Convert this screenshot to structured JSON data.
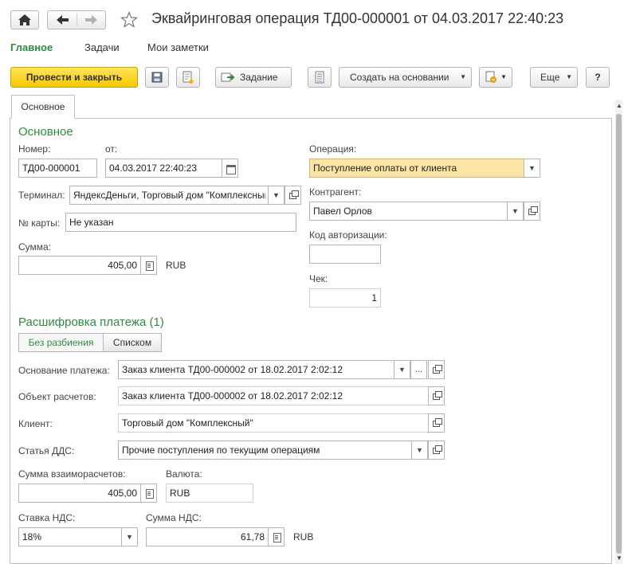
{
  "window": {
    "title": "Эквайринговая операция ТД00-000001 от 04.03.2017 22:40:23",
    "nav": [
      "Главное",
      "Задачи",
      "Мои заметки"
    ]
  },
  "toolbar": {
    "post_close": "Провести и закрыть",
    "task": "Задание",
    "create_based": "Создать на основании",
    "more": "Еще",
    "help": "?"
  },
  "tabs": {
    "main": "Основное"
  },
  "form": {
    "section_main": "Основное",
    "number_label": "Номер:",
    "number_value": "ТД00-000001",
    "date_label": "от:",
    "date_value": "04.03.2017 22:40:23",
    "operation_label": "Операция:",
    "operation_value": "Поступление оплаты от клиента",
    "terminal_label": "Терминал:",
    "terminal_value": "ЯндексДеньги, Торговый дом \"Комплексный\"",
    "counterparty_label": "Контрагент:",
    "counterparty_value": "Павел Орлов",
    "card_label": "№ карты:",
    "card_value": "Не указан",
    "auth_label": "Код авторизации:",
    "auth_value": "",
    "amount_label": "Сумма:",
    "amount_value": "405,00",
    "currency": "RUB",
    "check_label": "Чек:",
    "check_value": "1",
    "section_payment": "Расшифровка платежа (1)",
    "toggle_no_split": "Без разбиения",
    "toggle_list": "Списком",
    "basis_label": "Основание платежа:",
    "basis_value": "Заказ клиента ТД00-000002 от 18.02.2017 2:02:12",
    "settle_label": "Объект расчетов:",
    "settle_value": "Заказ клиента ТД00-000002 от 18.02.2017 2:02:12",
    "client_label": "Клиент:",
    "client_value": "Торговый дом \"Комплексный\"",
    "dds_label": "Статья ДДС:",
    "dds_value": "Прочие поступления по текущим операциям",
    "mutual_label": "Сумма взаиморасчетов:",
    "mutual_value": "405,00",
    "currency_label": "Валюта:",
    "currency_value": "RUB",
    "vat_rate_label": "Ставка НДС:",
    "vat_rate_value": "18%",
    "vat_sum_label": "Сумма НДС:",
    "vat_sum_value": "61,78",
    "vat_currency": "RUB"
  }
}
